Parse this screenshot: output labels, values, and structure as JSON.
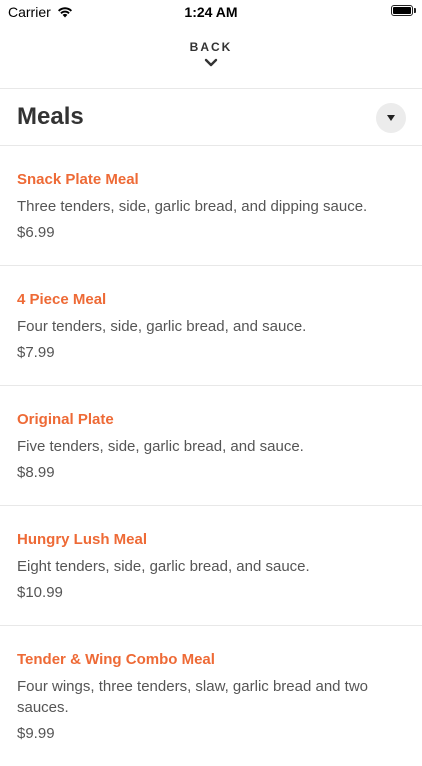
{
  "status_bar": {
    "carrier": "Carrier",
    "time": "1:24 AM",
    "icons": [
      "wifi-icon",
      "battery-icon"
    ]
  },
  "nav": {
    "back_label": "BACK",
    "back_icon": "chevron-down-icon"
  },
  "section": {
    "title": "Meals",
    "toggle_icon": "caret-down-icon"
  },
  "items": [
    {
      "name": "Snack Plate Meal",
      "description": "Three tenders, side, garlic bread, and dipping sauce.",
      "price": "$6.99"
    },
    {
      "name": "4 Piece Meal",
      "description": "Four tenders, side, garlic bread, and sauce.",
      "price": "$7.99"
    },
    {
      "name": "Original Plate",
      "description": "Five tenders, side, garlic bread, and sauce.",
      "price": "$8.99"
    },
    {
      "name": "Hungry Lush Meal",
      "description": "Eight tenders, side, garlic bread, and sauce.",
      "price": "$10.99"
    },
    {
      "name": "Tender & Wing Combo Meal",
      "description": "Four wings, three tenders, slaw, garlic bread and two sauces.",
      "price": "$9.99"
    }
  ],
  "colors": {
    "accent": "#ee6a36",
    "text": "#333333",
    "divider": "#e8e8e8"
  }
}
